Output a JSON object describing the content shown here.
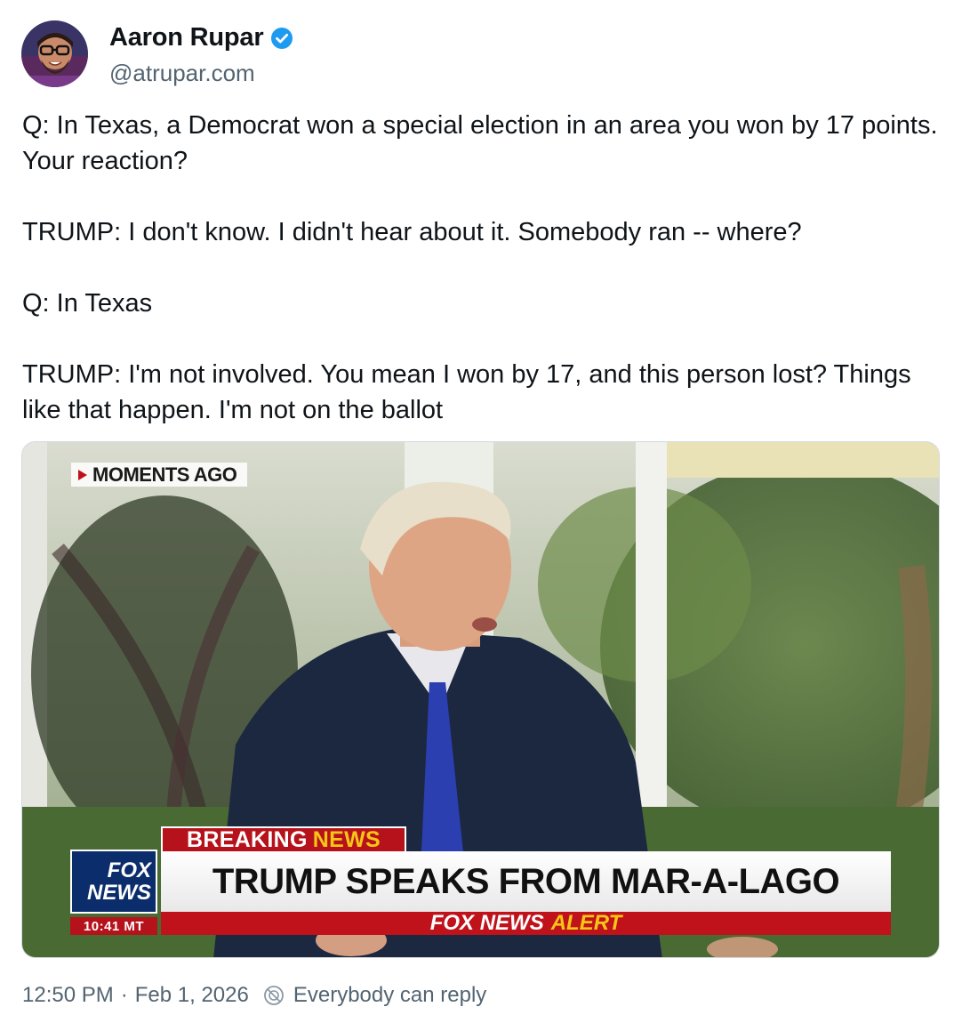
{
  "author": {
    "display_name": "Aaron Rupar",
    "handle": "@atrupar.com",
    "verified": true,
    "avatar_icon": "avatar-photo"
  },
  "post": {
    "paragraphs": [
      "Q: In Texas, a Democrat won a special election in an area you won by 17 points. Your reaction?",
      "TRUMP: I don't know. I didn't hear about it. Somebody ran -- where?",
      "Q: In Texas",
      "TRUMP: I'm not involved. You mean I won by 17, and this person lost? Things like that happen. I'm not on the ballot"
    ]
  },
  "media": {
    "moments_label": "MOMENTS AGO",
    "breaking_word1": "BREAKING",
    "breaking_word2": "NEWS",
    "headline": "TRUMP SPEAKS FROM MAR-A-LAGO",
    "alert_word1": "FOX NEWS",
    "alert_word2": "ALERT",
    "logo_line1": "FOX",
    "logo_line2": "NEWS",
    "time": "10:41 MT"
  },
  "footer": {
    "time": "12:50 PM",
    "date": "Feb 1, 2026",
    "reply_setting": "Everybody can reply",
    "reply_icon": "reply-permission-icon"
  },
  "colors": {
    "verified_blue": "#1d9bf0",
    "secondary_text": "#536471",
    "fox_red": "#b6121b",
    "fox_yellow": "#f6c516",
    "fox_blue": "#0c2d6b"
  }
}
